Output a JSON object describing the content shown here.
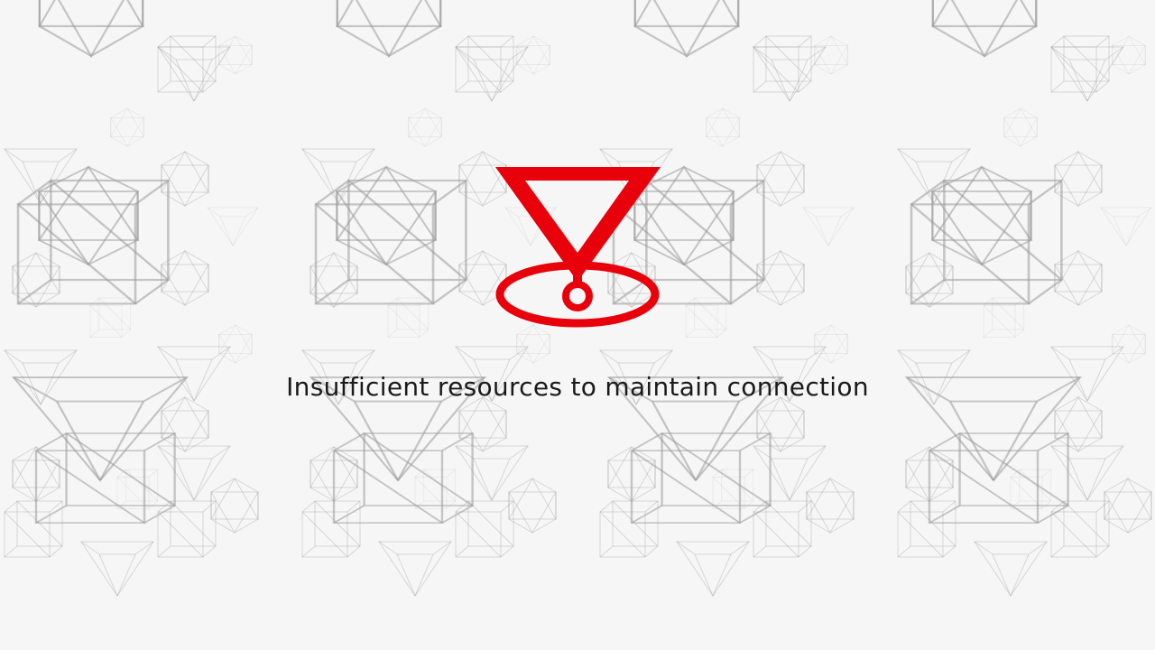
{
  "screen": {
    "background_color": "#f6f6f6",
    "pattern_stroke_color": "#8a8a8a",
    "pattern_icon": "wireframe-polyhedra-icon"
  },
  "error": {
    "icon": "disconnect-warning-icon",
    "icon_color": "#e8000b",
    "message": "Insufficient resources to maintain connection"
  }
}
